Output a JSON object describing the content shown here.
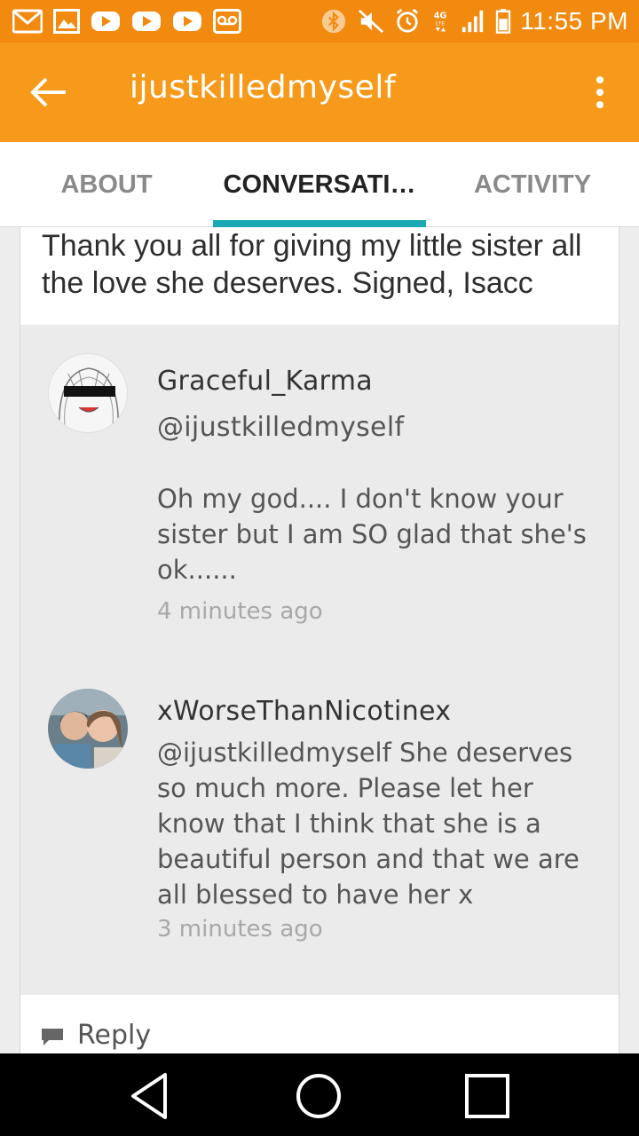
{
  "status_bar": {
    "time": "11:55 PM",
    "left_icons": [
      "gmail-icon",
      "gallery-icon",
      "youtube-icon",
      "youtube-icon",
      "youtube-icon",
      "voicemail-icon"
    ],
    "right_icons": [
      "bluetooth-icon",
      "mute-icon",
      "alarm-icon",
      "4g-lte-icon",
      "signal-icon",
      "battery-icon"
    ],
    "network_label": "4G"
  },
  "app_bar": {
    "title": "ijustkilledmyself",
    "back_icon": "arrow-left-icon",
    "menu_icon": "more-vert-icon"
  },
  "tabs": [
    {
      "label": "ABOUT",
      "active": false
    },
    {
      "label": "CONVERSATI…",
      "active": true
    },
    {
      "label": "ACTIVITY",
      "active": false
    }
  ],
  "post": {
    "text": "Thank you all for giving my little sister all the love she deserves. Signed, Isacc"
  },
  "comments": [
    {
      "username": "Graceful_Karma",
      "mention": "@ijustkilledmyself",
      "text": "Oh my god.... I don't know your sister but I am SO glad that she's ok......",
      "time": "4 minutes ago",
      "avatar": "anime-girl-avatar"
    },
    {
      "username": "xWorseThanNicotinex",
      "text": "@ijustkilledmyself She deserves so much more. Please let her know that I think that she is a beautiful person and that we are all blessed to have her x",
      "time": "3 minutes ago",
      "avatar": "selfie-photo-avatar"
    }
  ],
  "reply": {
    "label": "Reply",
    "icon": "comment-icon"
  },
  "nav_bar": {
    "buttons": [
      "back-triangle-icon",
      "home-circle-icon",
      "recents-square-icon"
    ]
  },
  "colors": {
    "status_bar": "#f28a0f",
    "app_bar": "#f79a1b",
    "tab_indicator": "#1aa9b3",
    "comments_bg": "#ebebeb"
  }
}
